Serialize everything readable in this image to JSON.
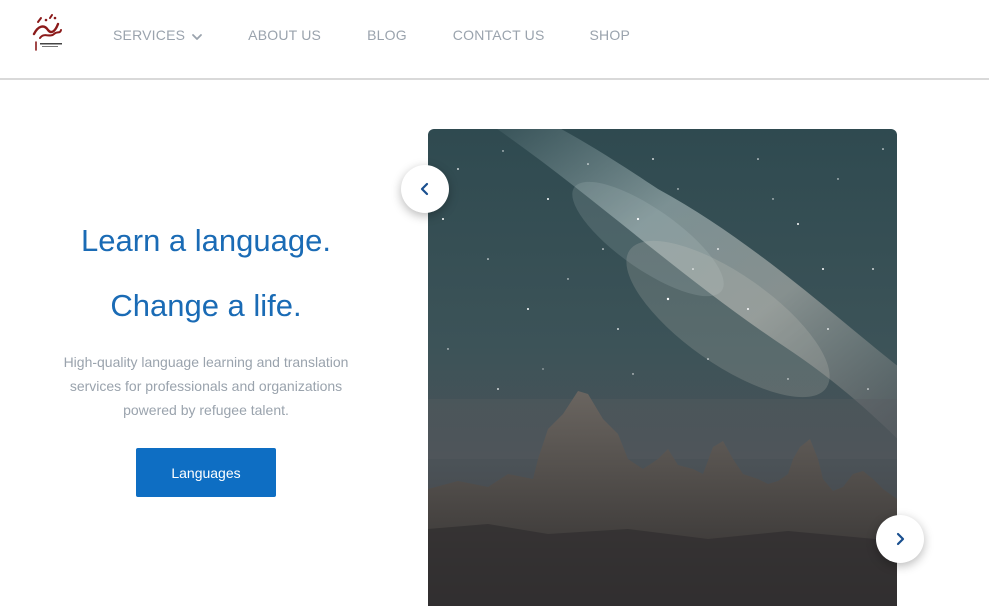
{
  "header": {
    "logo_icon": "takallam-calligraphy-logo",
    "nav": [
      {
        "label": "SERVICES",
        "has_dropdown": true
      },
      {
        "label": "ABOUT US"
      },
      {
        "label": "BLOG"
      },
      {
        "label": "CONTACT US"
      },
      {
        "label": "SHOP"
      }
    ]
  },
  "hero": {
    "title_line1": "Learn a language.",
    "title_line2": "Change a life.",
    "description": "High-quality language learning and translation services for professionals and organizations powered by refugee talent.",
    "cta_label": "Languages"
  },
  "carousel": {
    "image": "night-sky-milky-way-rock-spires",
    "prev_icon": "chevron-left-icon",
    "next_icon": "chevron-right-icon"
  },
  "colors": {
    "accent": "#1a6bb5",
    "button": "#0e6ec3",
    "nav_text": "#9aa3ad",
    "logo": "#8b1a1a"
  }
}
